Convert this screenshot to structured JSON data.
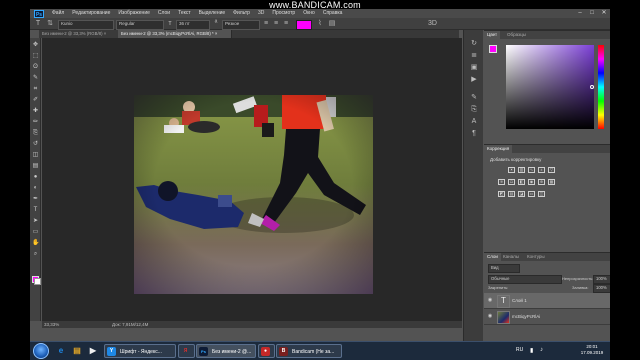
{
  "watermark": "www.BANDICAM.com",
  "app": {
    "logo": "Ps",
    "menu": [
      "Файл",
      "Редактирование",
      "Изображение",
      "Слои",
      "Текст",
      "Выделение",
      "Фильтр",
      "3D",
      "Просмотр",
      "Окно",
      "Справка"
    ],
    "window_controls": [
      "–",
      "□",
      "✕"
    ]
  },
  "options": {
    "font_family": "Kunio",
    "font_style": "Regular",
    "font_size": "36 пт",
    "antialias": "Резкое",
    "color": "#ff00ff"
  },
  "tabs": [
    {
      "label": "Без имени-2 @ 33,3% (RGB/8) ×",
      "active": false
    },
    {
      "label": "Без имени-2 @ 33,3% (mcBiqyPcRlAi, RGB/8) * ×",
      "active": true
    }
  ],
  "status": {
    "zoom": "33,33%",
    "doc": "Док: 7,91М/12,4М"
  },
  "tools": [
    "move-icon",
    "marquee-icon",
    "lasso-icon",
    "quick-select-icon",
    "crop-icon",
    "eyedropper-icon",
    "healing-icon",
    "brush-icon",
    "stamp-icon",
    "history-brush-icon",
    "eraser-icon",
    "gradient-icon",
    "blur-icon",
    "dodge-icon",
    "pen-icon",
    "type-icon",
    "path-select-icon",
    "shape-icon",
    "hand-icon",
    "zoom-icon"
  ],
  "tool_glyphs": [
    "✥",
    "⬚",
    "ʘ",
    "✎",
    "⌗",
    "✐",
    "✚",
    "✏",
    "⎘",
    "↺",
    "◫",
    "▤",
    "●",
    "◐",
    "✒",
    "T",
    "➤",
    "▭",
    "✋",
    "⌕"
  ],
  "panels": {
    "color": {
      "tabs": [
        "Цвет",
        "Образцы"
      ],
      "fg": "#ff00ff",
      "bg": "#ffffff"
    },
    "corrections": {
      "title": "Коррекция",
      "add_label": "Добавить корректировку"
    },
    "layers": {
      "tabs": [
        "Слои",
        "Каналы",
        "Контуры"
      ],
      "filter": "Вид",
      "blend_mode": "Обычные",
      "opacity_label": "Непрозрачность:",
      "opacity": "100%",
      "lock_label": "Закрепить:",
      "fill_label": "Заливка:",
      "fill": "100%",
      "items": [
        {
          "name": "Слой 1",
          "kind": "text",
          "selected": true
        },
        {
          "name": "mcBiqyPcRlAi",
          "kind": "image",
          "selected": false
        }
      ]
    }
  },
  "taskbar": {
    "pinned": [
      {
        "name": "ie-icon",
        "glyph": "e",
        "color": "#1e88e5"
      },
      {
        "name": "explorer-icon",
        "glyph": "▤",
        "color": "#e0a526"
      },
      {
        "name": "media-player-icon",
        "glyph": "▶",
        "color": "#f0f0f0"
      }
    ],
    "tasks": [
      {
        "label": "Шрифт - Яндекс...",
        "icon": "Y",
        "color": "#1e88e5"
      },
      {
        "label": "",
        "icon": "Я",
        "color": "#f5f5f5"
      },
      {
        "label": "Без имени-2 @...",
        "icon": "Ps",
        "color": "#0d1b36"
      },
      {
        "label": "",
        "icon": "●",
        "color": "#c62828"
      },
      {
        "label": "Bandicam (Не за...",
        "icon": "B",
        "color": "#7a1f1f"
      }
    ],
    "lang": "RU",
    "time": "20:01",
    "date": "17.09.2019"
  }
}
